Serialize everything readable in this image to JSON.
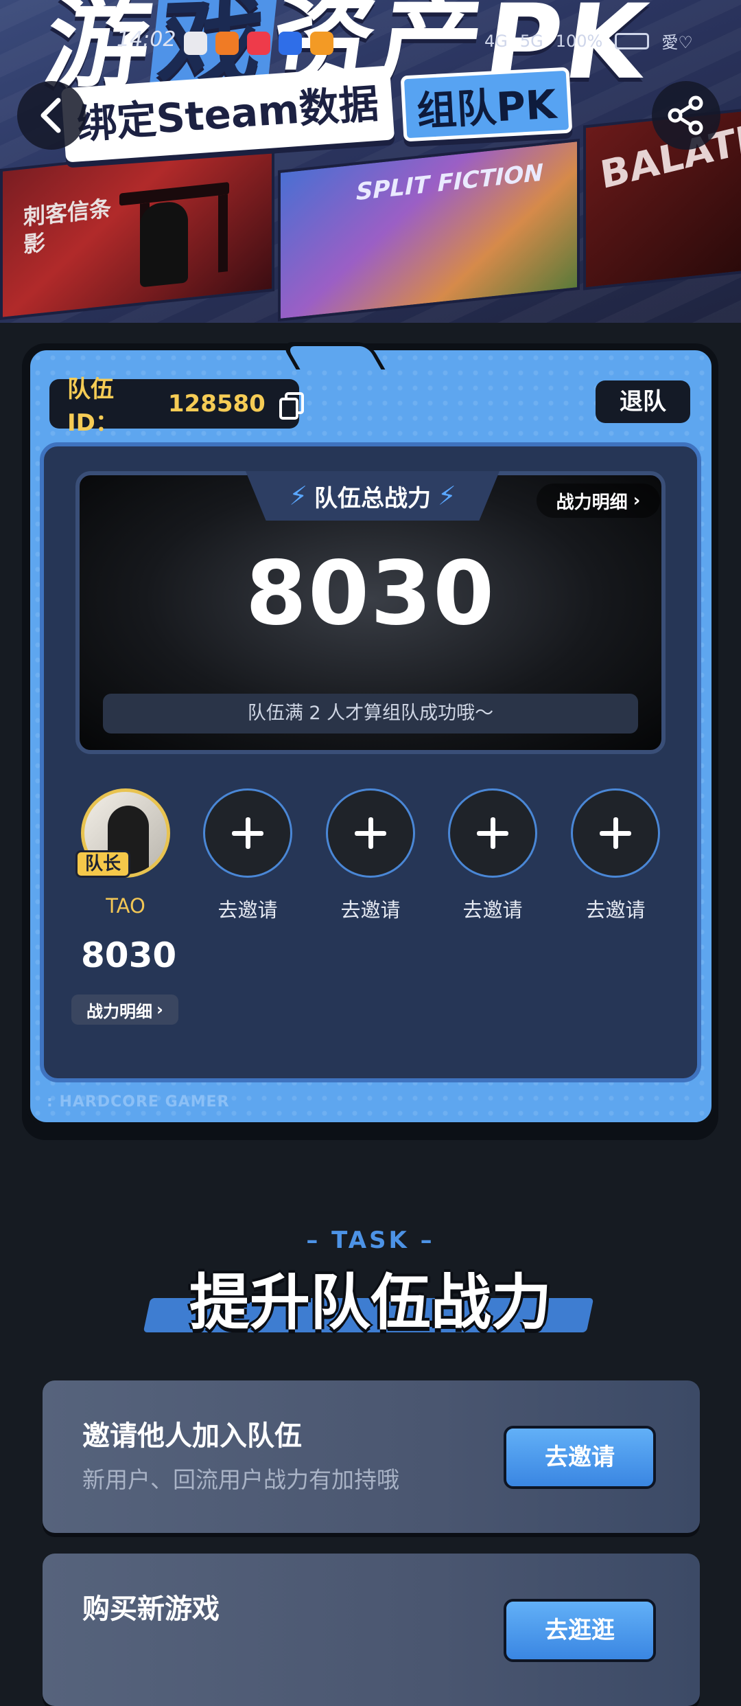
{
  "hero": {
    "title_part1": "游",
    "title_highlight": "戏",
    "title_part2": "资产PK",
    "tag_bind": "绑定Steam数据",
    "tag_team": "组队PK",
    "art_labels": [
      "刺客信条\n影",
      "SPLIT FICTION",
      "BALATRO"
    ]
  },
  "status_bar": {
    "time": "14:02",
    "network": "4G",
    "network2": "5G",
    "battery": "100%",
    "carrier": "愛♡"
  },
  "nav": {
    "back_icon": "chevron-left-icon",
    "share_icon": "share-icon"
  },
  "team": {
    "id_label": "队伍ID：",
    "id_value": "128580",
    "quit_label": "退队",
    "power_title": "队伍总战力",
    "power_detail_label": "战力明细",
    "total_power": "8030",
    "note": "队伍满 2 人才算组队成功哦～",
    "members": [
      {
        "name": "TAO",
        "badge": "队长",
        "score": "8030",
        "detail_label": "战力明细"
      }
    ],
    "invite_slots": [
      "去邀请",
      "去邀请",
      "去邀请",
      "去邀请"
    ],
    "footer_text": ": HARDCORE GAMER"
  },
  "task": {
    "kicker": "– TASK –",
    "title": "提升队伍战力",
    "items": [
      {
        "title": "邀请他人加入队伍",
        "subtitle": "新用户、回流用户战力有加持哦",
        "button": "去邀请"
      },
      {
        "title": "购买新游戏",
        "subtitle": "",
        "button": "去逛逛"
      }
    ]
  },
  "colors": {
    "accent_blue": "#5ea6ef",
    "gold": "#f6cc55",
    "dark_bg": "#161b22"
  }
}
